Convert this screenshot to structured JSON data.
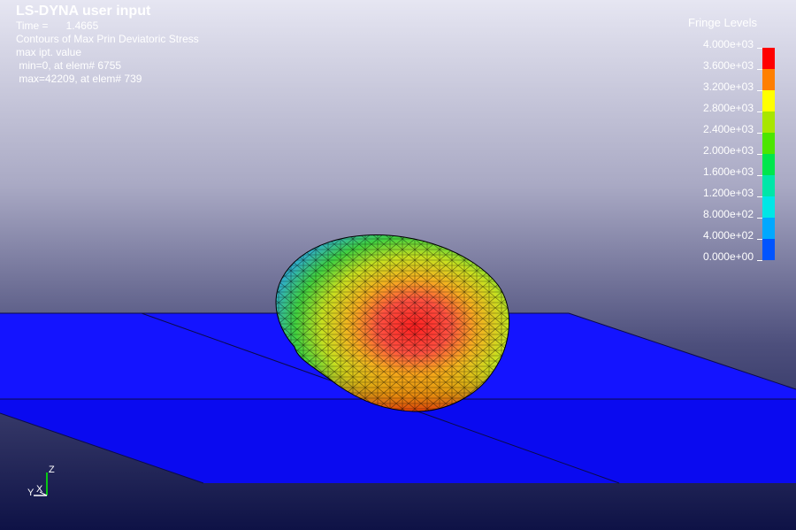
{
  "header": {
    "title": "LS-DYNA user input",
    "time_label": "Time =",
    "time_value": "1.4665",
    "contour_label": "Contours of Max Prin Deviatoric Stress",
    "value_type": "max ipt. value",
    "min_text": " min=0, at elem# 6755",
    "max_text": " max=42209, at elem# 739"
  },
  "legend": {
    "title": "Fringe Levels",
    "levels": [
      "4.000e+03",
      "3.600e+03",
      "3.200e+03",
      "2.800e+03",
      "2.400e+03",
      "2.000e+03",
      "1.600e+03",
      "1.200e+03",
      "8.000e+02",
      "4.000e+02",
      "0.000e+00"
    ],
    "colors": [
      "#ff0000",
      "#ff7f00",
      "#ffff00",
      "#a8e600",
      "#4ce600",
      "#00e64c",
      "#00e6a8",
      "#00e6e6",
      "#00a8ff",
      "#0054ff",
      "#0000ff"
    ]
  },
  "triad": {
    "z_label": "Z",
    "x_label": "X",
    "y_label": "Y"
  }
}
